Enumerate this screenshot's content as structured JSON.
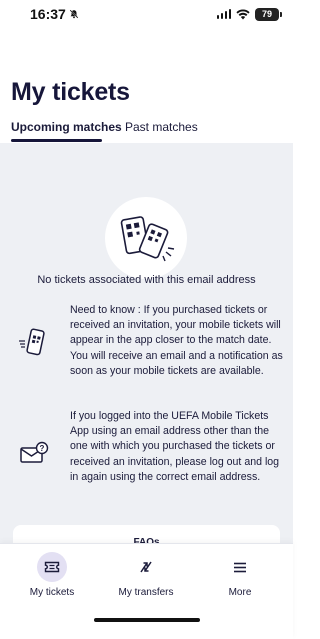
{
  "status_bar": {
    "time": "16:37",
    "battery": "79",
    "icons": [
      "bell-muted-icon",
      "signal-icon",
      "wifi-icon",
      "battery-icon"
    ]
  },
  "page": {
    "title": "My tickets"
  },
  "tabs": [
    {
      "label": "Upcoming matches",
      "active": true
    },
    {
      "label": "Past matches",
      "active": false
    }
  ],
  "empty_state": {
    "illustration": "qr-tickets-icon",
    "message": "No tickets associated with this email address"
  },
  "info": [
    {
      "icon": "mobile-ticket-icon",
      "text": "Need to know : If you purchased tickets or received an invitation, your mobile tickets will appear in the app closer to the match date. You will receive an email and a notification as soon as your mobile tickets are available."
    },
    {
      "icon": "email-question-icon",
      "text": "If you logged into the UEFA Mobile Tickets App using an email address other than the one with which you purchased the tickets or received an invitation, please log out and log in again using the correct email address."
    }
  ],
  "faq": {
    "title": "FAQs"
  },
  "bottom_nav": [
    {
      "label": "My tickets",
      "icon": "ticket-icon",
      "active": true
    },
    {
      "label": "My transfers",
      "icon": "transfer-icon",
      "active": false
    },
    {
      "label": "More",
      "icon": "menu-icon",
      "active": false
    }
  ],
  "colors": {
    "primary": "#16163a",
    "content_background": "#eef0f4",
    "active_nav_background": "#e3e0f3"
  }
}
